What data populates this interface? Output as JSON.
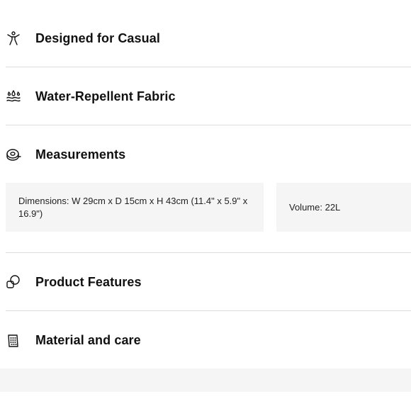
{
  "sections": [
    {
      "title": "Designed for Casual",
      "icon": "person-icon"
    },
    {
      "title": "Water-Repellent Fabric",
      "icon": "water-drops-icon"
    },
    {
      "title": "Measurements",
      "icon": "tape-measure-icon"
    },
    {
      "title": "Product Features",
      "icon": "features-icon"
    },
    {
      "title": "Material and care",
      "icon": "fabric-tag-icon"
    }
  ],
  "measurements": {
    "dimensions": "Dimensions: W 29cm x D 15cm x H 43cm (11.4\" x 5.9\" x 16.9\")",
    "volume": "Volume: 22L"
  }
}
